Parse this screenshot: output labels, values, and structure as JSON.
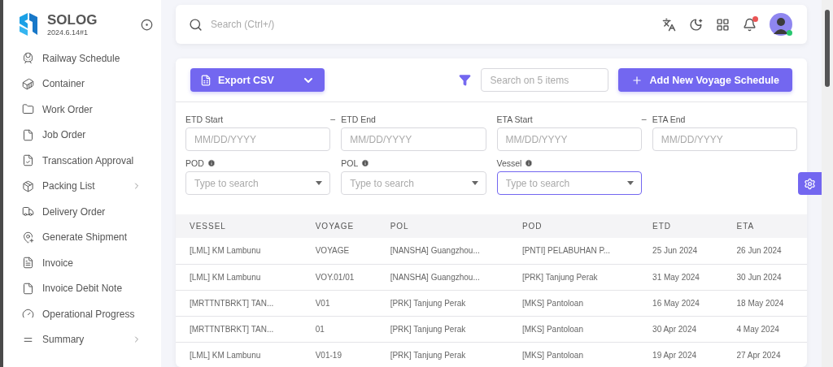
{
  "app": {
    "name": "SOLOG",
    "version": "2024.6.14#1"
  },
  "sidebar": {
    "items": [
      {
        "label": "Railway Schedule",
        "has_submenu": false
      },
      {
        "label": "Container",
        "has_submenu": false
      },
      {
        "label": "Work Order",
        "has_submenu": false
      },
      {
        "label": "Job Order",
        "has_submenu": false
      },
      {
        "label": "Transcation Approval",
        "has_submenu": false
      },
      {
        "label": "Packing List",
        "has_submenu": true
      },
      {
        "label": "Delivery Order",
        "has_submenu": false
      },
      {
        "label": "Generate Shipment",
        "has_submenu": false
      },
      {
        "label": "Invoice",
        "has_submenu": false
      },
      {
        "label": "Invoice Debit Note",
        "has_submenu": false
      },
      {
        "label": "Operational Progress",
        "has_submenu": false
      },
      {
        "label": "Summary",
        "has_submenu": true
      }
    ]
  },
  "topbar": {
    "search_placeholder": "Search (Ctrl+/)",
    "notifications_unread": true,
    "user_online": true
  },
  "toolbar": {
    "export_button": "Export CSV",
    "search_placeholder": "Search on 5 items",
    "add_button": "Add New Voyage Schedule"
  },
  "filters": {
    "date_fields": [
      {
        "label": "ETD Start",
        "placeholder": "MM/DD/YYYY"
      },
      {
        "label": "ETD End",
        "separator": "–",
        "placeholder": "MM/DD/YYYY"
      },
      {
        "label": "ETA Start",
        "placeholder": "MM/DD/YYYY"
      },
      {
        "label": "ETA End",
        "separator": "–",
        "placeholder": "MM/DD/YYYY"
      }
    ],
    "select_fields": [
      {
        "label": "POD",
        "placeholder": "Type to search",
        "focused": false
      },
      {
        "label": "POL",
        "placeholder": "Type to search",
        "focused": false
      },
      {
        "label": "Vessel",
        "placeholder": "Type to search",
        "focused": true
      }
    ]
  },
  "table": {
    "columns": [
      "VESSEL",
      "VOYAGE",
      "POL",
      "POD",
      "ETD",
      "ETA"
    ],
    "rows": [
      [
        "[LML] KM Lambunu",
        "VOYAGE",
        "[NANSHA] Guangzhou...",
        "[PNTI] PELABUHAN P...",
        "25 Jun 2024",
        "26 Jun 2024"
      ],
      [
        "[LML] KM Lambunu",
        "VOY.01/01",
        "[NANSHA] Guangzhou...",
        "[PRK] Tanjung Perak",
        "31 May 2024",
        "30 Jun 2024"
      ],
      [
        "[MRTTNTBRKT] TAN...",
        "V01",
        "[PRK] Tanjung Perak",
        "[MKS] Pantoloan",
        "16 May 2024",
        "18 May 2024"
      ],
      [
        "[MRTTNTBRKT] TAN...",
        "01",
        "[PRK] Tanjung Perak",
        "[MKS] Pantoloan",
        "30 Apr 2024",
        "4 May 2024"
      ],
      [
        "[LML] KM Lambunu",
        "V01-19",
        "[PRK] Tanjung Perak",
        "[MKS] Pantoloan",
        "19 Apr 2024",
        "27 Apr 2024"
      ]
    ]
  }
}
